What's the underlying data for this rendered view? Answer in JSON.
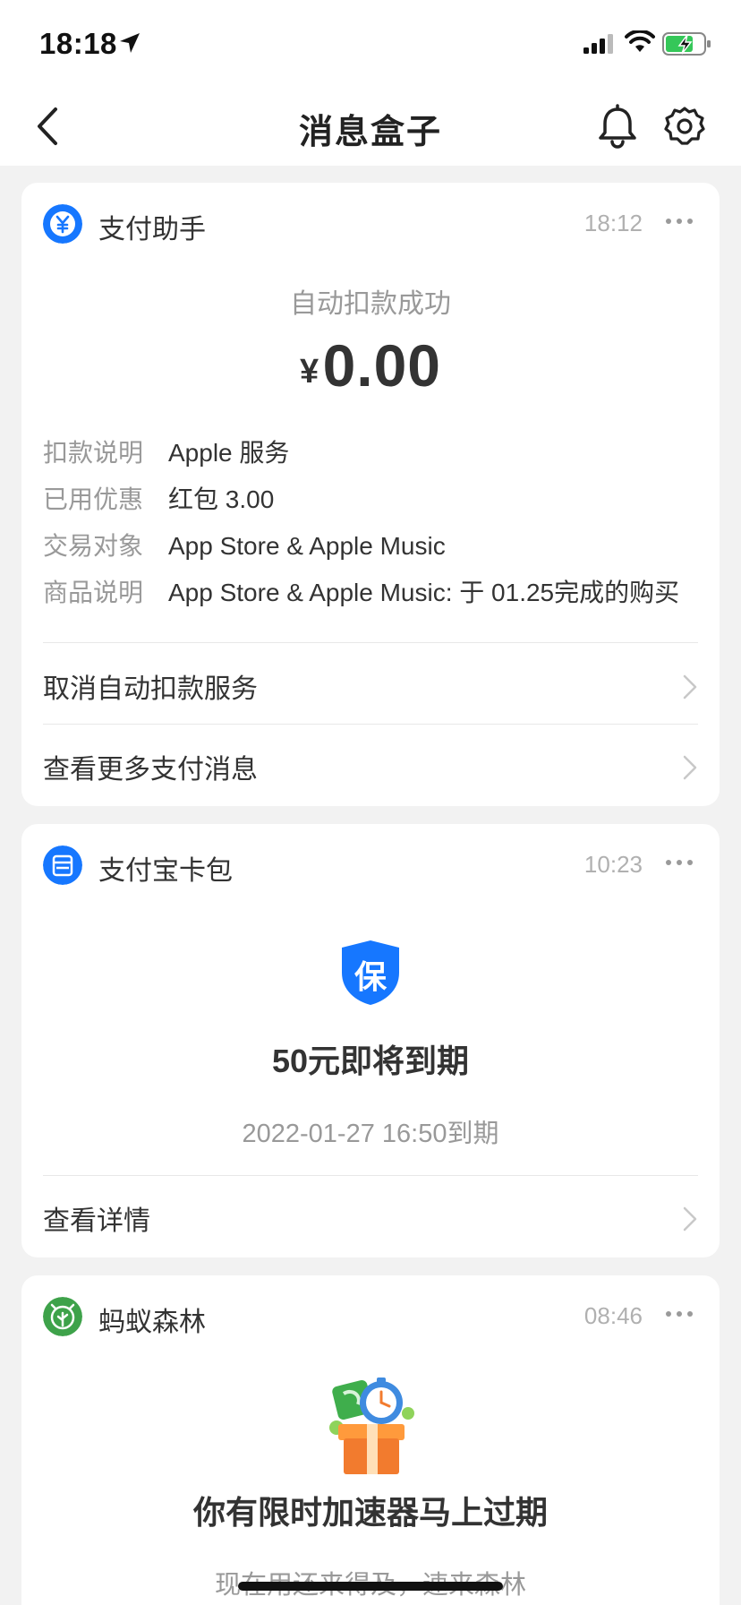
{
  "status_bar": {
    "time": "18:18"
  },
  "nav": {
    "title": "消息盒子"
  },
  "cards": [
    {
      "source": "支付助手",
      "time": "18:12",
      "headline": "自动扣款成功",
      "amount_currency": "¥",
      "amount_value": "0.00",
      "details": [
        {
          "key": "扣款说明",
          "value": "Apple 服务"
        },
        {
          "key": "已用优惠",
          "value": "红包 3.00"
        },
        {
          "key": "交易对象",
          "value": "App Store & Apple Music"
        },
        {
          "key": "商品说明",
          "value": "App Store & Apple Music: 于 01.25完成的购买"
        }
      ],
      "links": [
        "取消自动扣款服务",
        "查看更多支付消息"
      ]
    },
    {
      "source": "支付宝卡包",
      "time": "10:23",
      "badge_char": "保",
      "headline": "50元即将到期",
      "subline": "2022-01-27 16:50到期",
      "links": [
        "查看详情"
      ]
    },
    {
      "source": "蚂蚁森林",
      "time": "08:46",
      "headline": "你有限时加速器马上过期",
      "subline": "现在用还来得及，速来森林"
    }
  ],
  "colors": {
    "brand_blue": "#1677ff",
    "forest_green": "#3ea24a",
    "page_bg": "#f2f2f2",
    "muted_text": "#999999"
  },
  "icons": [
    "location-arrow-icon",
    "signal-icon",
    "wifi-icon",
    "battery-charging-icon",
    "back-arrow-icon",
    "bell-icon",
    "gear-icon",
    "yuan-icon",
    "card-wallet-icon",
    "forest-icon",
    "more-icon",
    "chevron-right-icon",
    "shield-icon",
    "gift-box-icon"
  ]
}
